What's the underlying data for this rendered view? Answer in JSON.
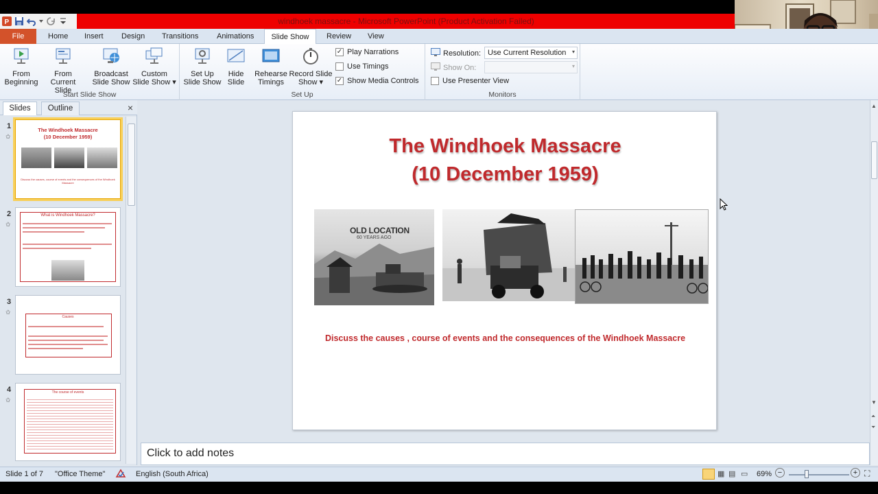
{
  "window": {
    "title": "windhoek massacre  -  Microsoft PowerPoint (Product Activation Failed)"
  },
  "tabs": [
    {
      "label": "File"
    },
    {
      "label": "Home"
    },
    {
      "label": "Insert"
    },
    {
      "label": "Design"
    },
    {
      "label": "Transitions"
    },
    {
      "label": "Animations"
    },
    {
      "label": "Slide Show",
      "active": true
    },
    {
      "label": "Review"
    },
    {
      "label": "View"
    }
  ],
  "ribbon": {
    "start_group": {
      "name": "Start Slide Show",
      "from_beginning": [
        "From",
        "Beginning"
      ],
      "from_current": [
        "From",
        "Current Slide"
      ],
      "broadcast": [
        "Broadcast",
        "Slide Show"
      ],
      "custom": [
        "Custom",
        "Slide Show ▾"
      ]
    },
    "setup_group": {
      "name": "Set Up",
      "set_up": [
        "Set Up",
        "Slide Show"
      ],
      "hide": [
        "Hide",
        "Slide"
      ],
      "rehearse": [
        "Rehearse",
        "Timings"
      ],
      "record": [
        "Record Slide",
        "Show ▾"
      ],
      "play_narrations": "Play Narrations",
      "use_timings": "Use Timings",
      "show_media_controls": "Show Media Controls",
      "play_narrations_checked": true,
      "use_timings_checked": false,
      "show_media_controls_checked": true
    },
    "monitors_group": {
      "name": "Monitors",
      "resolution_label": "Resolution:",
      "resolution_value": "Use Current Resolution",
      "show_on_label": "Show On:",
      "show_on_value": "",
      "presenter_view": "Use Presenter View",
      "presenter_view_checked": false
    }
  },
  "pane": {
    "tab_slides": "Slides",
    "tab_outline": "Outline",
    "close": "×"
  },
  "thumbnails": [
    {
      "num": "1",
      "title": "The Windhoek Massacre",
      "title2": "(10 December 1959)",
      "caption": "Discuss the causes, course of events and the consequences of the Windhoek Massacre"
    },
    {
      "num": "2",
      "title": "What is Windhoek Massacre?"
    },
    {
      "num": "3",
      "title": "Causes"
    },
    {
      "num": "4",
      "title": "The course of events"
    }
  ],
  "slide": {
    "title_line1": "The Windhoek Massacre",
    "title_line2": "(10 December 1959)",
    "photo1_caption_line1": "OLD LOCATION",
    "photo1_caption_line2": "60 YEARS AGO",
    "subtitle": "Discuss the causes , course of events and the consequences  of the Windhoek Massacre"
  },
  "notes": {
    "placeholder": "Click to add notes"
  },
  "status": {
    "slide_info": "Slide 1 of 7",
    "theme": "\"Office Theme\"",
    "language": "English (South Africa)",
    "zoom": "69%",
    "zoom_minus": "−",
    "zoom_plus": "+"
  },
  "colors": {
    "title_red": "#c0292c",
    "titlebar_red": "#ee0000",
    "file_tab": "#d3522a",
    "selected_thumb": "#f8d05a"
  }
}
